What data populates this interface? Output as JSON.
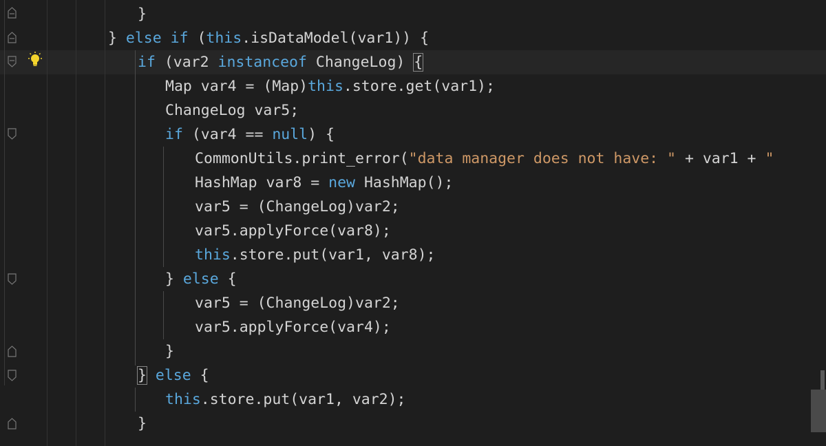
{
  "editor": {
    "lines": [
      {
        "parts": [
          {
            "t": "}",
            "c": ""
          }
        ]
      },
      {
        "parts": [
          {
            "t": "} ",
            "c": ""
          },
          {
            "t": "else",
            "c": "kw"
          },
          {
            "t": " ",
            "c": ""
          },
          {
            "t": "if",
            "c": "kw"
          },
          {
            "t": " (",
            "c": ""
          },
          {
            "t": "this",
            "c": "kw"
          },
          {
            "t": ".isDataModel(var1)) {",
            "c": ""
          }
        ]
      },
      {
        "parts": [
          {
            "t": "if",
            "c": "kw"
          },
          {
            "t": " (var2 ",
            "c": ""
          },
          {
            "t": "instanceof",
            "c": "kw"
          },
          {
            "t": " ChangeLog) ",
            "c": ""
          },
          {
            "t": "{",
            "c": "brace"
          }
        ]
      },
      {
        "parts": [
          {
            "t": "Map var4 = (Map)",
            "c": ""
          },
          {
            "t": "this",
            "c": "kw"
          },
          {
            "t": ".store.get(var1);",
            "c": ""
          }
        ]
      },
      {
        "parts": [
          {
            "t": "ChangeLog var5;",
            "c": ""
          }
        ]
      },
      {
        "parts": [
          {
            "t": "if",
            "c": "kw"
          },
          {
            "t": " (var4 == ",
            "c": ""
          },
          {
            "t": "null",
            "c": "kw"
          },
          {
            "t": ") {",
            "c": ""
          }
        ]
      },
      {
        "parts": [
          {
            "t": "CommonUtils.print_error(",
            "c": ""
          },
          {
            "t": "\"data manager does not have: \"",
            "c": "str"
          },
          {
            "t": " + var1 + ",
            "c": ""
          },
          {
            "t": "\"",
            "c": "str"
          }
        ]
      },
      {
        "parts": [
          {
            "t": "HashMap var8 = ",
            "c": ""
          },
          {
            "t": "new",
            "c": "kw"
          },
          {
            "t": " HashMap();",
            "c": ""
          }
        ]
      },
      {
        "parts": [
          {
            "t": "var5 = (ChangeLog)var2;",
            "c": ""
          }
        ]
      },
      {
        "parts": [
          {
            "t": "var5.applyForce(var8);",
            "c": ""
          }
        ]
      },
      {
        "parts": [
          {
            "t": "this",
            "c": "kw"
          },
          {
            "t": ".store.put(var1, var8);",
            "c": ""
          }
        ]
      },
      {
        "parts": [
          {
            "t": "} ",
            "c": ""
          },
          {
            "t": "else",
            "c": "kw"
          },
          {
            "t": " {",
            "c": ""
          }
        ]
      },
      {
        "parts": [
          {
            "t": "var5 = (ChangeLog)var2;",
            "c": ""
          }
        ]
      },
      {
        "parts": [
          {
            "t": "var5.applyForce(var4);",
            "c": ""
          }
        ]
      },
      {
        "parts": [
          {
            "t": "}",
            "c": ""
          }
        ]
      },
      {
        "parts": [
          {
            "t": "}",
            "c": "brace"
          },
          {
            "t": " ",
            "c": ""
          },
          {
            "t": "else",
            "c": "kw"
          },
          {
            "t": " {",
            "c": ""
          }
        ]
      },
      {
        "parts": [
          {
            "t": "this",
            "c": "kw"
          },
          {
            "t": ".store.put(var1, var2);",
            "c": ""
          }
        ]
      },
      {
        "parts": [
          {
            "t": "}",
            "c": ""
          }
        ]
      }
    ]
  },
  "icons": {
    "lightbulb": "lightbulb-icon",
    "fold": "fold-marker-icon"
  },
  "colors": {
    "background": "#1e1e1e",
    "keyword": "#5aa8dd",
    "string": "#ce9866",
    "text": "#d4d4d4",
    "bulb": "#f3d42d"
  }
}
